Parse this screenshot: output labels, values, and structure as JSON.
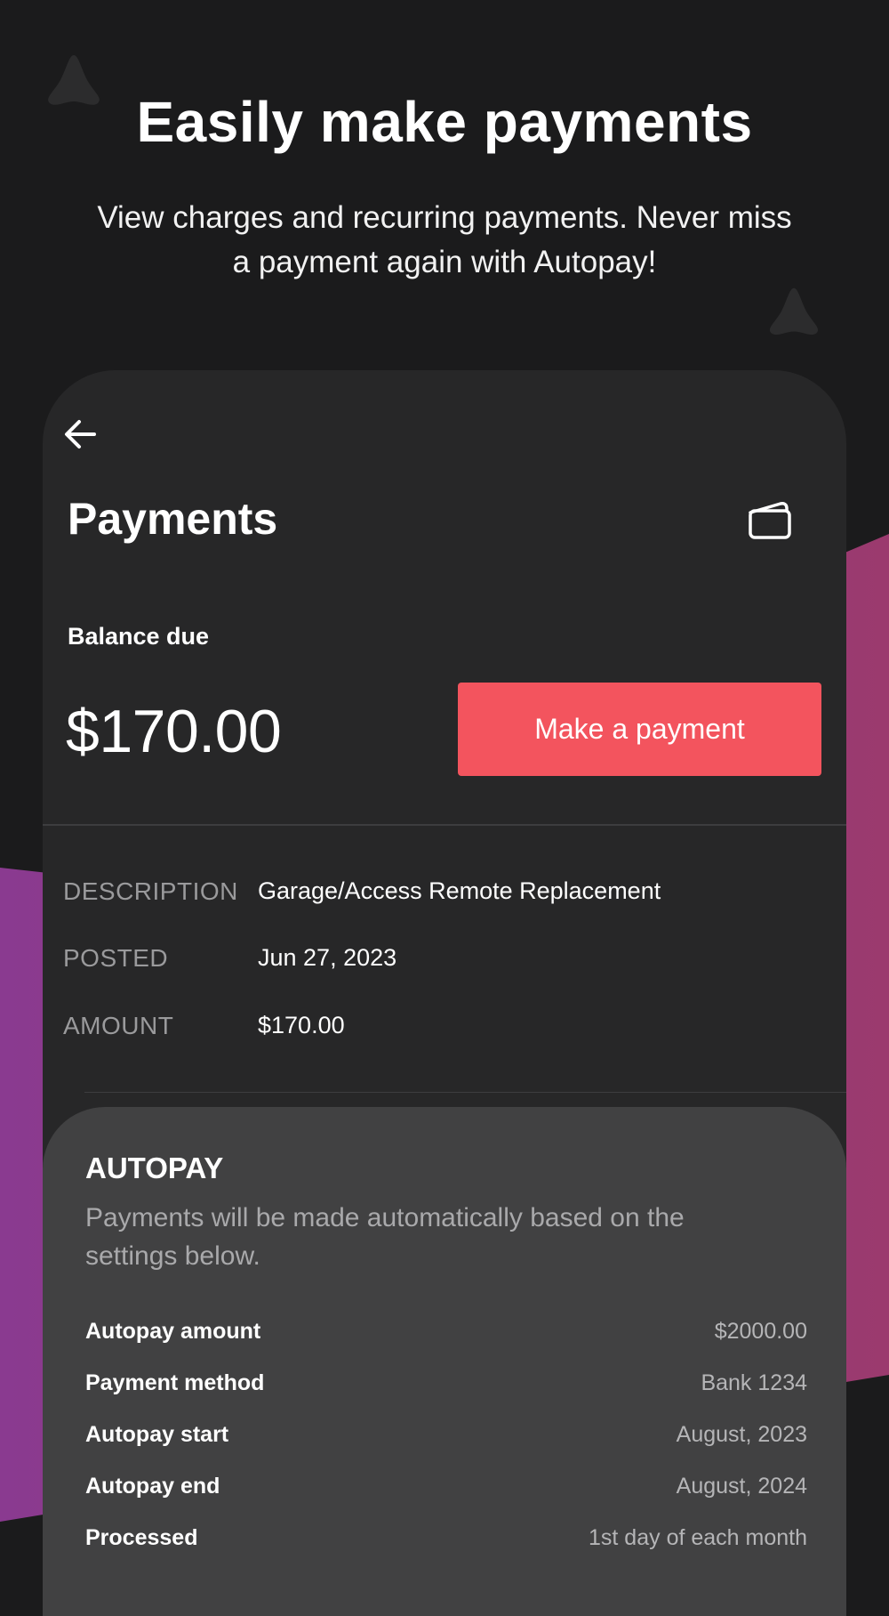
{
  "hero": {
    "title": "Easily make payments",
    "subtitle": "View charges and recurring payments. Never miss a payment again with Autopay!"
  },
  "screen": {
    "back_icon": "arrow-left-icon",
    "title": "Payments",
    "wallet_icon": "wallet-icon",
    "balance_label": "Balance due",
    "balance_amount": "$170.00",
    "pay_button_label": "Make a payment"
  },
  "charge": {
    "rows": [
      {
        "label": "DESCRIPTION",
        "value": "Garage/Access Remote Replacement"
      },
      {
        "label": "POSTED",
        "value": "Jun 27, 2023"
      },
      {
        "label": "AMOUNT",
        "value": "$170.00"
      }
    ]
  },
  "autopay": {
    "title": "AUTOPAY",
    "description": "Payments will be made automatically based on the settings below.",
    "rows": [
      {
        "label": "Autopay amount",
        "value": "$2000.00"
      },
      {
        "label": "Payment method",
        "value": "Bank 1234"
      },
      {
        "label": "Autopay start",
        "value": "August, 2023"
      },
      {
        "label": "Autopay end",
        "value": "August, 2024"
      },
      {
        "label": "Processed",
        "value": "1st day of each month"
      }
    ]
  },
  "colors": {
    "background": "#1b1b1c",
    "card": "#272728",
    "autopay_card": "#414142",
    "accent": "#f3545e",
    "band_start": "#8a3a90",
    "band_end": "#9b3a6e"
  }
}
